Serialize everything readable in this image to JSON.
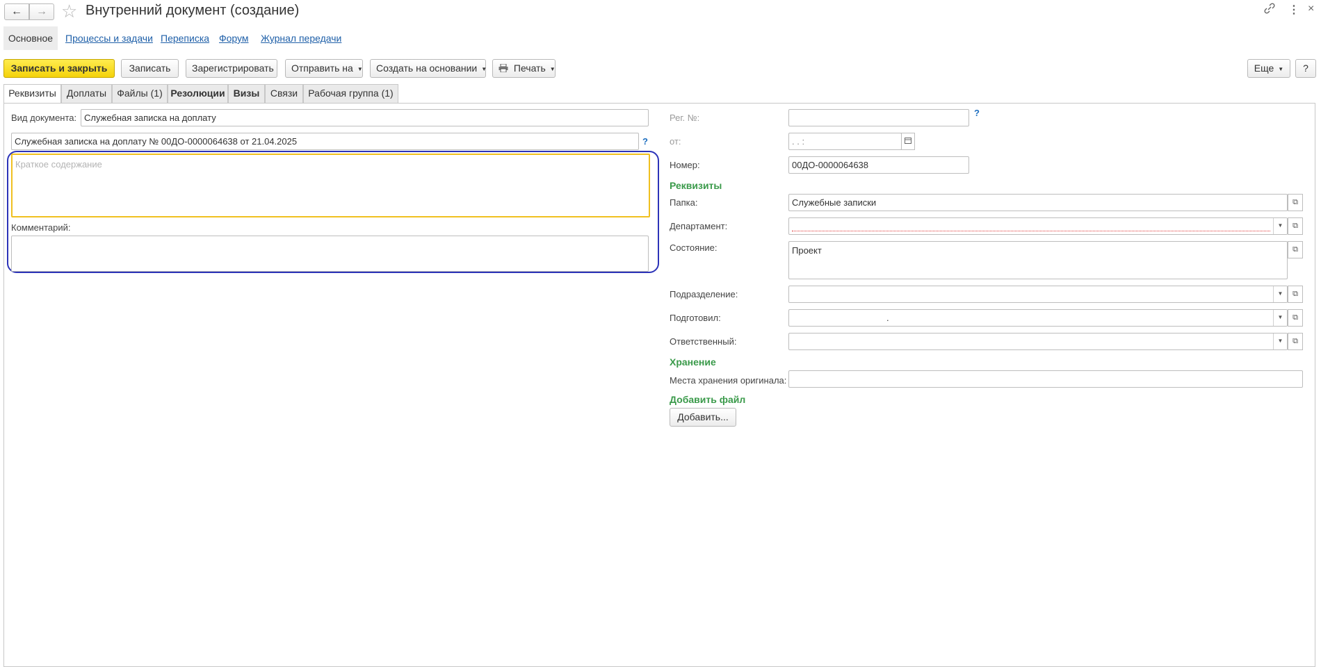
{
  "window": {
    "title": "Внутренний документ (создание)",
    "back_icon": "arrow-left-icon",
    "forward_icon": "arrow-right-icon",
    "favorite_icon": "star-icon"
  },
  "nav_tabs": {
    "active": "Основное",
    "items": [
      "Процессы и задачи",
      "Переписка",
      "Форум",
      "Журнал передачи"
    ]
  },
  "toolbar": {
    "save_close": "Записать и закрыть",
    "save": "Записать",
    "register": "Зарегистрировать",
    "send_to": "Отправить на",
    "create_based": "Создать на основании",
    "print": "Печать",
    "more": "Еще",
    "help": "?"
  },
  "tabs": [
    "Реквизиты",
    "Доплаты",
    "Файлы (1)",
    "Резолюции",
    "Визы",
    "Связи",
    "Рабочая группа (1)"
  ],
  "left": {
    "doc_type_label": "Вид документа:",
    "doc_type_value": "Служебная записка на доплату",
    "doc_title": "Служебная записка на доплату № 00ДО-0000064638 от 21.04.2025",
    "help_mark": "?",
    "summary_placeholder": "Краткое содержание",
    "comment_label": "Комментарий:"
  },
  "right": {
    "reg_no_label": "Рег. №:",
    "from_label": "от:",
    "from_value": " .  .       :",
    "number_label": "Номер:",
    "number_value": "00ДО-0000064638",
    "props_section": "Реквизиты",
    "folder_label": "Папка:",
    "folder_value": "Служебные записки",
    "department_label": "Департамент:",
    "state_label": "Состояние:",
    "state_value": "Проект",
    "subdivision_label": "Подразделение:",
    "prepared_label": "Подготовил:",
    "prepared_value": ".",
    "responsible_label": "Ответственный:",
    "storage_section": "Хранение",
    "storage_place_label": "Места хранения оригинала:",
    "add_file_section": "Добавить файл",
    "add_button": "Добавить...",
    "help_mark": "?"
  },
  "colors": {
    "primary_button": "#f4d20b",
    "section_header": "#3a9a4a",
    "link": "#1e5fa8",
    "highlight_frame": "#2c33b8",
    "focus_border": "#f0c020"
  }
}
